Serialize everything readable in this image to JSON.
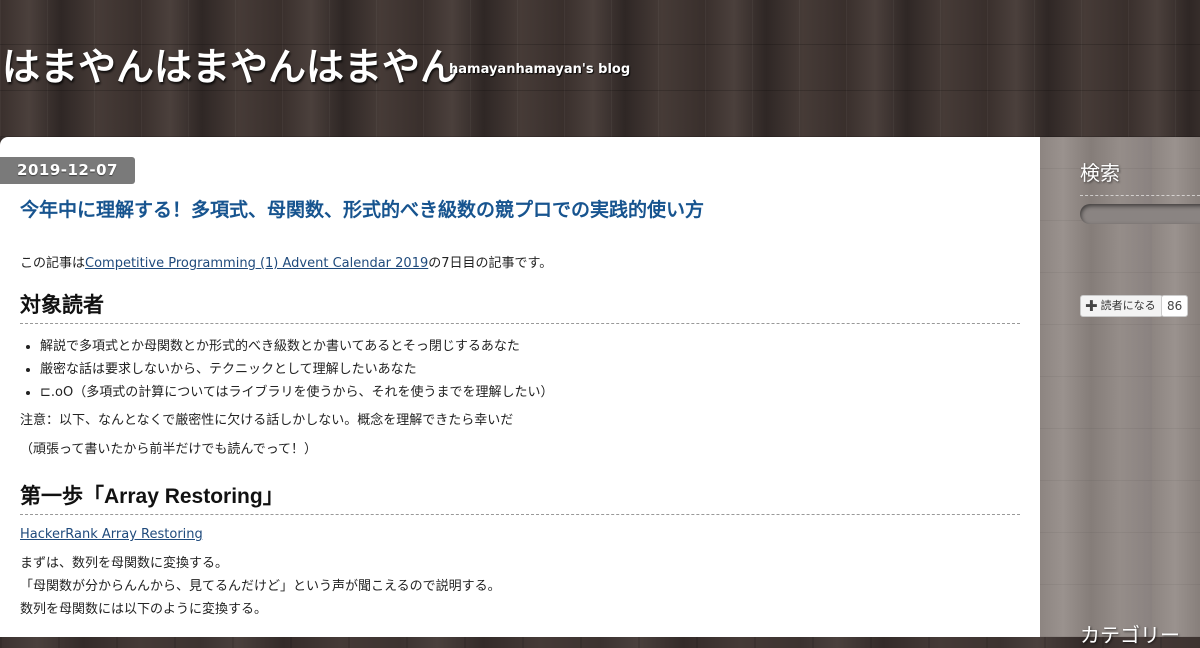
{
  "header": {
    "blog_title": "はまやんはまやんはまやん",
    "blog_description": "hamayanhamayan's blog"
  },
  "entry": {
    "date": "2019-12-07",
    "title": "今年中に理解する！多項式、母関数、形式的べき級数の競プロでの実践的使い方",
    "intro_prefix": "この記事は",
    "intro_link": "Competitive Programming (1) Advent Calendar 2019",
    "intro_suffix": "の7日目の記事です。",
    "section1": {
      "heading": "対象読者",
      "items": [
        "解説で多項式とか母関数とか形式的べき級数とか書いてあるとそっ閉じするあなた",
        "厳密な話は要求しないから、テクニックとして理解したいあなた",
        "⊏.oO（多項式の計算についてはライブラリを使うから、それを使うまでを理解したい）"
      ],
      "note1": "注意：以下、なんとなくで厳密性に欠ける話しかしない。概念を理解できたら幸いだ",
      "note2": "（頑張って書いたから前半だけでも読んでって！）"
    },
    "section2": {
      "heading": "第一歩「Array Restoring」",
      "link": "HackerRank Array Restoring",
      "line1": "まずは、数列を母関数に変換する。",
      "line2": "「母関数が分からんんから、見てるんだけど」という声が聞こえるので説明する。",
      "line3": "数列を母関数には以下のように変換する。"
    }
  },
  "sidebar": {
    "search_heading": "検索",
    "search_placeholder": "",
    "reader_button_icon": "plus-icon",
    "reader_button_label": "読者になる",
    "reader_count": "86",
    "category_heading": "カテゴリー"
  },
  "colors": {
    "title_link": "#17548f",
    "body_link": "#1f4a7c",
    "date_badge": "#7a7a7a"
  }
}
